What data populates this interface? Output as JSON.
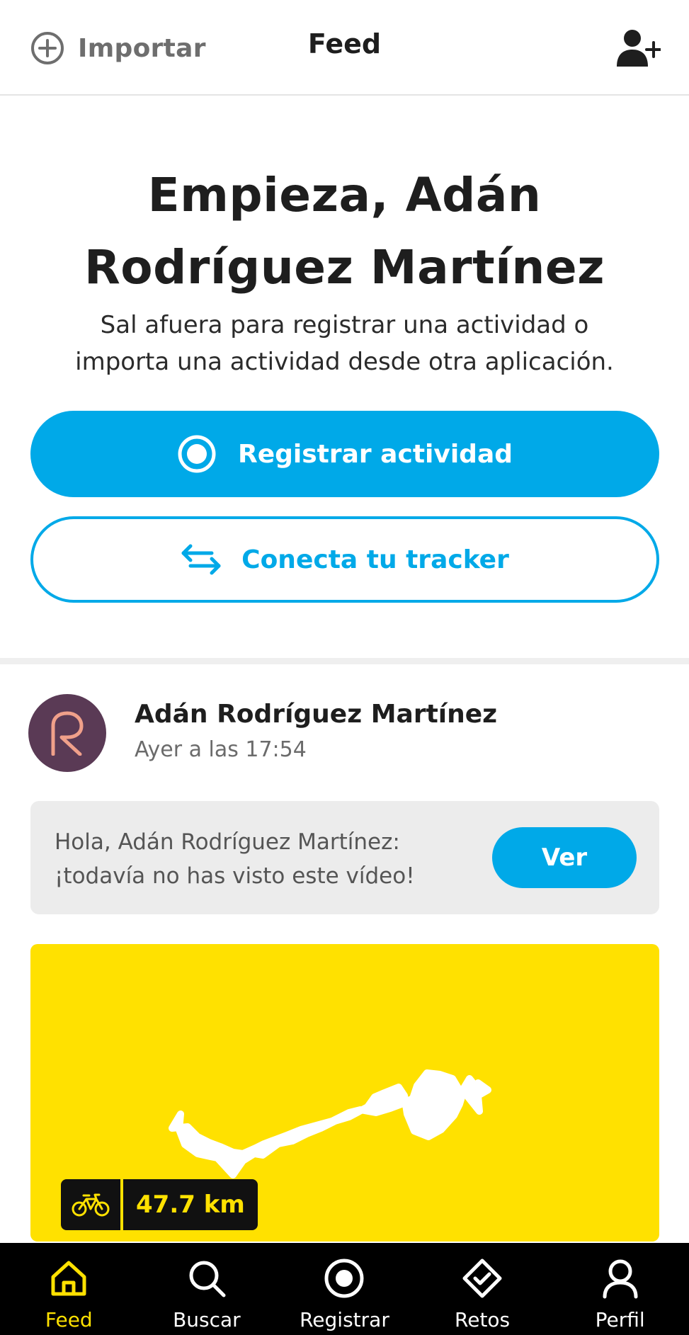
{
  "header": {
    "import_label": "Importar",
    "title": "Feed"
  },
  "hero": {
    "title_line1": "Empieza, Adán",
    "title_line2": "Rodríguez Martínez",
    "subtitle_line1": "Sal afuera para registrar una actividad o",
    "subtitle_line2": "importa una actividad desde otra aplicación.",
    "primary_button": "Registrar actividad",
    "secondary_button": "Conecta tu tracker"
  },
  "post": {
    "author": "Adán Rodríguez Martínez",
    "time": "Ayer a las 17:54",
    "notice_line1": "Hola, Adán Rodríguez Martínez:",
    "notice_line2": "¡todavía no has visto este vídeo!",
    "notice_button": "Ver",
    "activity_type_icon": "bike-icon",
    "distance": "47.7 km"
  },
  "nav": {
    "items": [
      {
        "label": "Feed",
        "icon": "home-icon",
        "active": true
      },
      {
        "label": "Buscar",
        "icon": "search-icon",
        "active": false
      },
      {
        "label": "Registrar",
        "icon": "record-icon",
        "active": false
      },
      {
        "label": "Retos",
        "icon": "challenge-icon",
        "active": false
      },
      {
        "label": "Perfil",
        "icon": "profile-icon",
        "active": false
      }
    ]
  },
  "colors": {
    "accent": "#00a9e8",
    "brand_yellow": "#ffe100",
    "nav_background": "#000000",
    "avatar": "#5a3a55"
  }
}
